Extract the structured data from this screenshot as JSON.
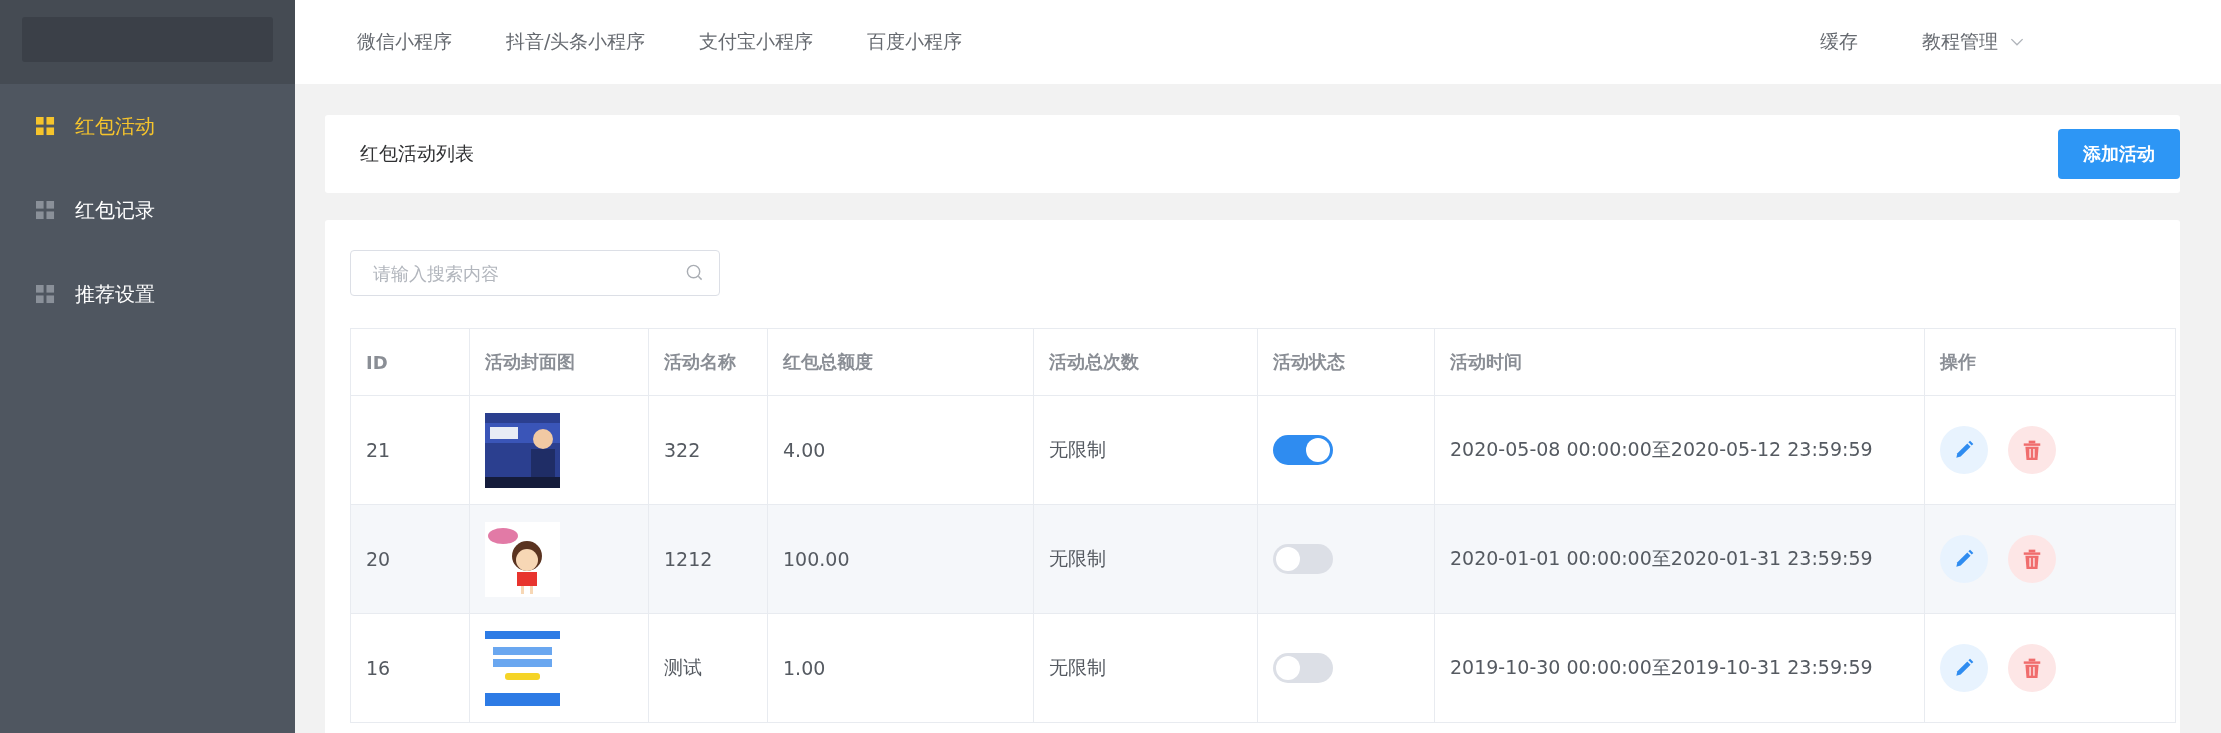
{
  "sidebar": {
    "items": [
      {
        "label": "红包活动",
        "selected": true
      },
      {
        "label": "红包记录",
        "selected": false
      },
      {
        "label": "推荐设置",
        "selected": false
      }
    ]
  },
  "top_nav": {
    "tabs": [
      "微信小程序",
      "抖音/头条小程序",
      "支付宝小程序",
      "百度小程序"
    ],
    "right": {
      "cache": "缓存",
      "menu": "教程管理"
    }
  },
  "header": {
    "title": "红包活动列表",
    "add_button": "添加活动"
  },
  "search": {
    "placeholder": "请输入搜索内容"
  },
  "table": {
    "columns": [
      "ID",
      "活动封面图",
      "活动名称",
      "红包总额度",
      "活动总次数",
      "活动状态",
      "活动时间",
      "操作"
    ],
    "rows": [
      {
        "id": "21",
        "name": "322",
        "amount": "4.00",
        "count": "无限制",
        "enabled": true,
        "time": "2020-05-08 00:00:00至2020-05-12 23:59:59"
      },
      {
        "id": "20",
        "name": "1212",
        "amount": "100.00",
        "count": "无限制",
        "enabled": false,
        "time": "2020-01-01 00:00:00至2020-01-31 23:59:59"
      },
      {
        "id": "16",
        "name": "测试",
        "amount": "1.00",
        "count": "无限制",
        "enabled": false,
        "time": "2019-10-30 00:00:00至2019-10-31 23:59:59"
      }
    ]
  }
}
